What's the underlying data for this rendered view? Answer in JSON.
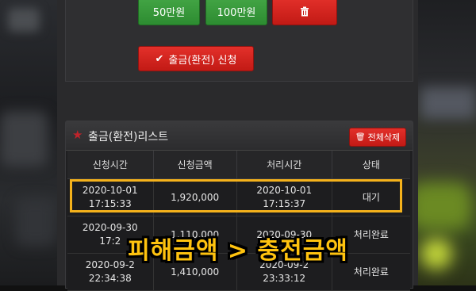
{
  "amount_buttons": {
    "fifty": "50만원",
    "hundred": "100만원",
    "delete_icon": "trash-icon"
  },
  "withdraw_button": {
    "label": "출금(환전) 신청",
    "icon": "check-icon"
  },
  "list": {
    "title": "출금(환전)리스트",
    "delete_all_label": "전체삭제",
    "columns": [
      "신청시간",
      "신청금액",
      "처리시간",
      "상태"
    ],
    "rows": [
      {
        "request_date": "2020-10-01",
        "request_time": "17:15:33",
        "amount": "1,920,000",
        "process_date": "2020-10-01",
        "process_time": "17:15:37",
        "status": "대기"
      },
      {
        "request_date": "2020-09-30",
        "request_time": "17:2",
        "amount": "1,110,000",
        "process_date": "2020-09-30",
        "process_time": "",
        "status": "처리완료"
      },
      {
        "request_date": "2020-09-2",
        "request_time": "22:34:38",
        "amount": "1,410,000",
        "process_date": "2020-09-2",
        "process_time": "23:33:12",
        "status": "처리완료"
      }
    ]
  },
  "overlay_caption": "피해금액 > 충전금액",
  "colors": {
    "green_button": "#2d8c31",
    "red_button": "#c21a15",
    "highlight": "#f5b21b",
    "caption": "#ffc30f"
  }
}
